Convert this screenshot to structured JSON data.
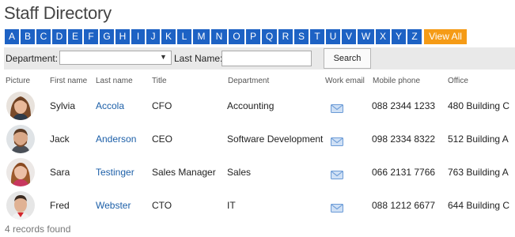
{
  "page": {
    "title": "Staff Directory"
  },
  "alphabet": [
    "A",
    "B",
    "C",
    "D",
    "E",
    "F",
    "G",
    "H",
    "I",
    "J",
    "K",
    "L",
    "M",
    "N",
    "O",
    "P",
    "Q",
    "R",
    "S",
    "T",
    "U",
    "V",
    "W",
    "X",
    "Y",
    "Z"
  ],
  "view_all": "View All",
  "filter": {
    "department_label": "Department:",
    "department_value": "",
    "lastname_label": "Last Name:",
    "lastname_value": "",
    "search_button": "Search"
  },
  "columns": {
    "picture": "Picture",
    "first_name": "First name",
    "last_name": "Last name",
    "title": "Title",
    "department": "Department",
    "work_email": "Work email",
    "mobile": "Mobile phone",
    "office": "Office"
  },
  "staff": [
    {
      "first": "Sylvia",
      "last": "Accola",
      "title": "CFO",
      "department": "Accounting",
      "mobile": "088 2344 1233",
      "office": "480 Building C"
    },
    {
      "first": "Jack",
      "last": "Anderson",
      "title": "CEO",
      "department": "Software Development",
      "mobile": "098 2334 8322",
      "office": "512 Building A"
    },
    {
      "first": "Sara",
      "last": "Testinger",
      "title": "Sales Manager",
      "department": "Sales",
      "mobile": "066 2131 7766",
      "office": "763 Building A"
    },
    {
      "first": "Fred",
      "last": "Webster",
      "title": "CTO",
      "department": "IT",
      "mobile": "088 1212 6677",
      "office": "644 Building C"
    }
  ],
  "footer": "4 records found",
  "colors": {
    "letter_bg": "#1d62c4",
    "view_all_bg": "#f59b16",
    "link": "#1c5fa8",
    "filter_bg": "#e9e9e9",
    "mail_icon": "#6a9ad6"
  }
}
